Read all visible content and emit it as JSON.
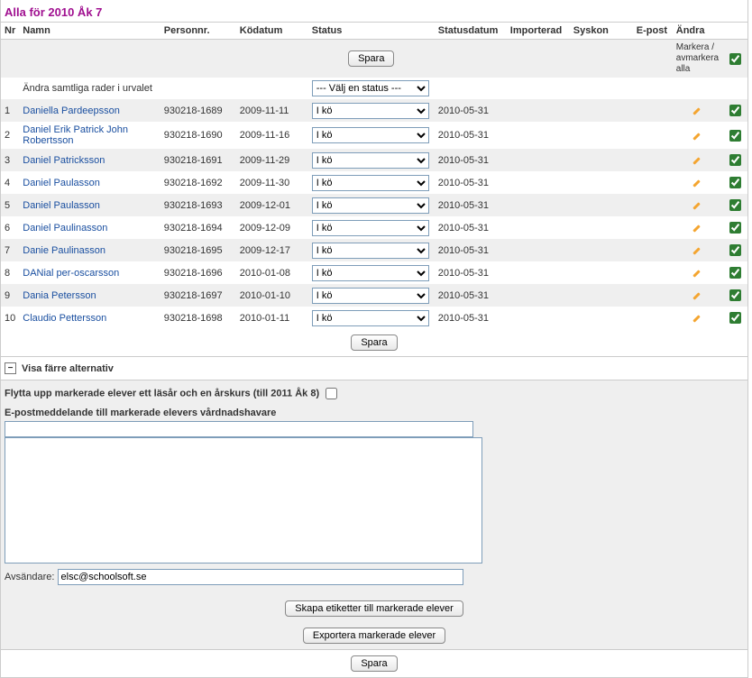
{
  "title": "Alla för 2010 Åk 7",
  "headers": {
    "nr": "Nr",
    "namn": "Namn",
    "personnr": "Personnr.",
    "kodatum": "Ködatum",
    "status": "Status",
    "statusdatum": "Statusdatum",
    "importerad": "Importerad",
    "syskon": "Syskon",
    "epost": "E-post",
    "andra": "Ändra",
    "mark_all": "Markera / avmarkera alla"
  },
  "buttons": {
    "spara": "Spara",
    "skapa_etiketter": "Skapa etiketter till markerade elever",
    "exportera": "Exportera markerade elever"
  },
  "bulk_row_label": "Ändra samtliga rader i urvalet",
  "bulk_status_placeholder": "--- Välj en status ---",
  "row_status_value": "I kö",
  "rows": [
    {
      "nr": "1",
      "namn": "Daniella Pardeepsson",
      "personnr": "930218-1689",
      "kodatum": "2009-11-11",
      "statusdatum": "2010-05-31"
    },
    {
      "nr": "2",
      "namn": "Daniel Erik Patrick John Robertsson",
      "personnr": "930218-1690",
      "kodatum": "2009-11-16",
      "statusdatum": "2010-05-31"
    },
    {
      "nr": "3",
      "namn": "Daniel Patricksson",
      "personnr": "930218-1691",
      "kodatum": "2009-11-29",
      "statusdatum": "2010-05-31"
    },
    {
      "nr": "4",
      "namn": "Daniel Paulasson",
      "personnr": "930218-1692",
      "kodatum": "2009-11-30",
      "statusdatum": "2010-05-31"
    },
    {
      "nr": "5",
      "namn": "Daniel Paulasson",
      "personnr": "930218-1693",
      "kodatum": "2009-12-01",
      "statusdatum": "2010-05-31"
    },
    {
      "nr": "6",
      "namn": "Daniel Paulinasson",
      "personnr": "930218-1694",
      "kodatum": "2009-12-09",
      "statusdatum": "2010-05-31"
    },
    {
      "nr": "7",
      "namn": "Danie Paulinasson",
      "personnr": "930218-1695",
      "kodatum": "2009-12-17",
      "statusdatum": "2010-05-31"
    },
    {
      "nr": "8",
      "namn": "DANial per-oscarsson",
      "personnr": "930218-1696",
      "kodatum": "2010-01-08",
      "statusdatum": "2010-05-31"
    },
    {
      "nr": "9",
      "namn": "Dania Petersson",
      "personnr": "930218-1697",
      "kodatum": "2010-01-10",
      "statusdatum": "2010-05-31"
    },
    {
      "nr": "10",
      "namn": "Claudio Pettersson",
      "personnr": "930218-1698",
      "kodatum": "2010-01-11",
      "statusdatum": "2010-05-31"
    }
  ],
  "alt_header": "Visa färre alternativ",
  "collapse_glyph": "−",
  "opt": {
    "move_up_label": "Flytta upp markerade elever ett läsår och en årskurs (till 2011 Åk 8)",
    "email_label": "E-postmeddelande till markerade elevers vårdnadshavare",
    "sender_label": "Avsändare:",
    "sender_value": "elsc@schoolsoft.se"
  }
}
